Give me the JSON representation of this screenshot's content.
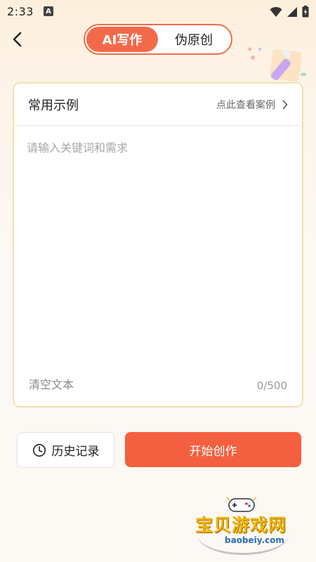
{
  "status_bar": {
    "time": "2:33",
    "notif_letter": "A"
  },
  "tabs": [
    {
      "label": "AI写作",
      "active": true
    },
    {
      "label": "伪原创",
      "active": false
    }
  ],
  "examples": {
    "title": "常用示例",
    "link": "点此查看案例"
  },
  "editor": {
    "placeholder": "请输入关键词和需求",
    "value": "",
    "clear_label": "清空文本",
    "counter": "0/500"
  },
  "actions": {
    "history_label": "历史记录",
    "start_label": "开始创作"
  },
  "watermark": {
    "name": "宝贝游戏网",
    "url": "baobeiy.com"
  },
  "colors": {
    "accent": "#f36a4a",
    "card_border": "#f7dfae",
    "start_button": "#f2603f"
  }
}
